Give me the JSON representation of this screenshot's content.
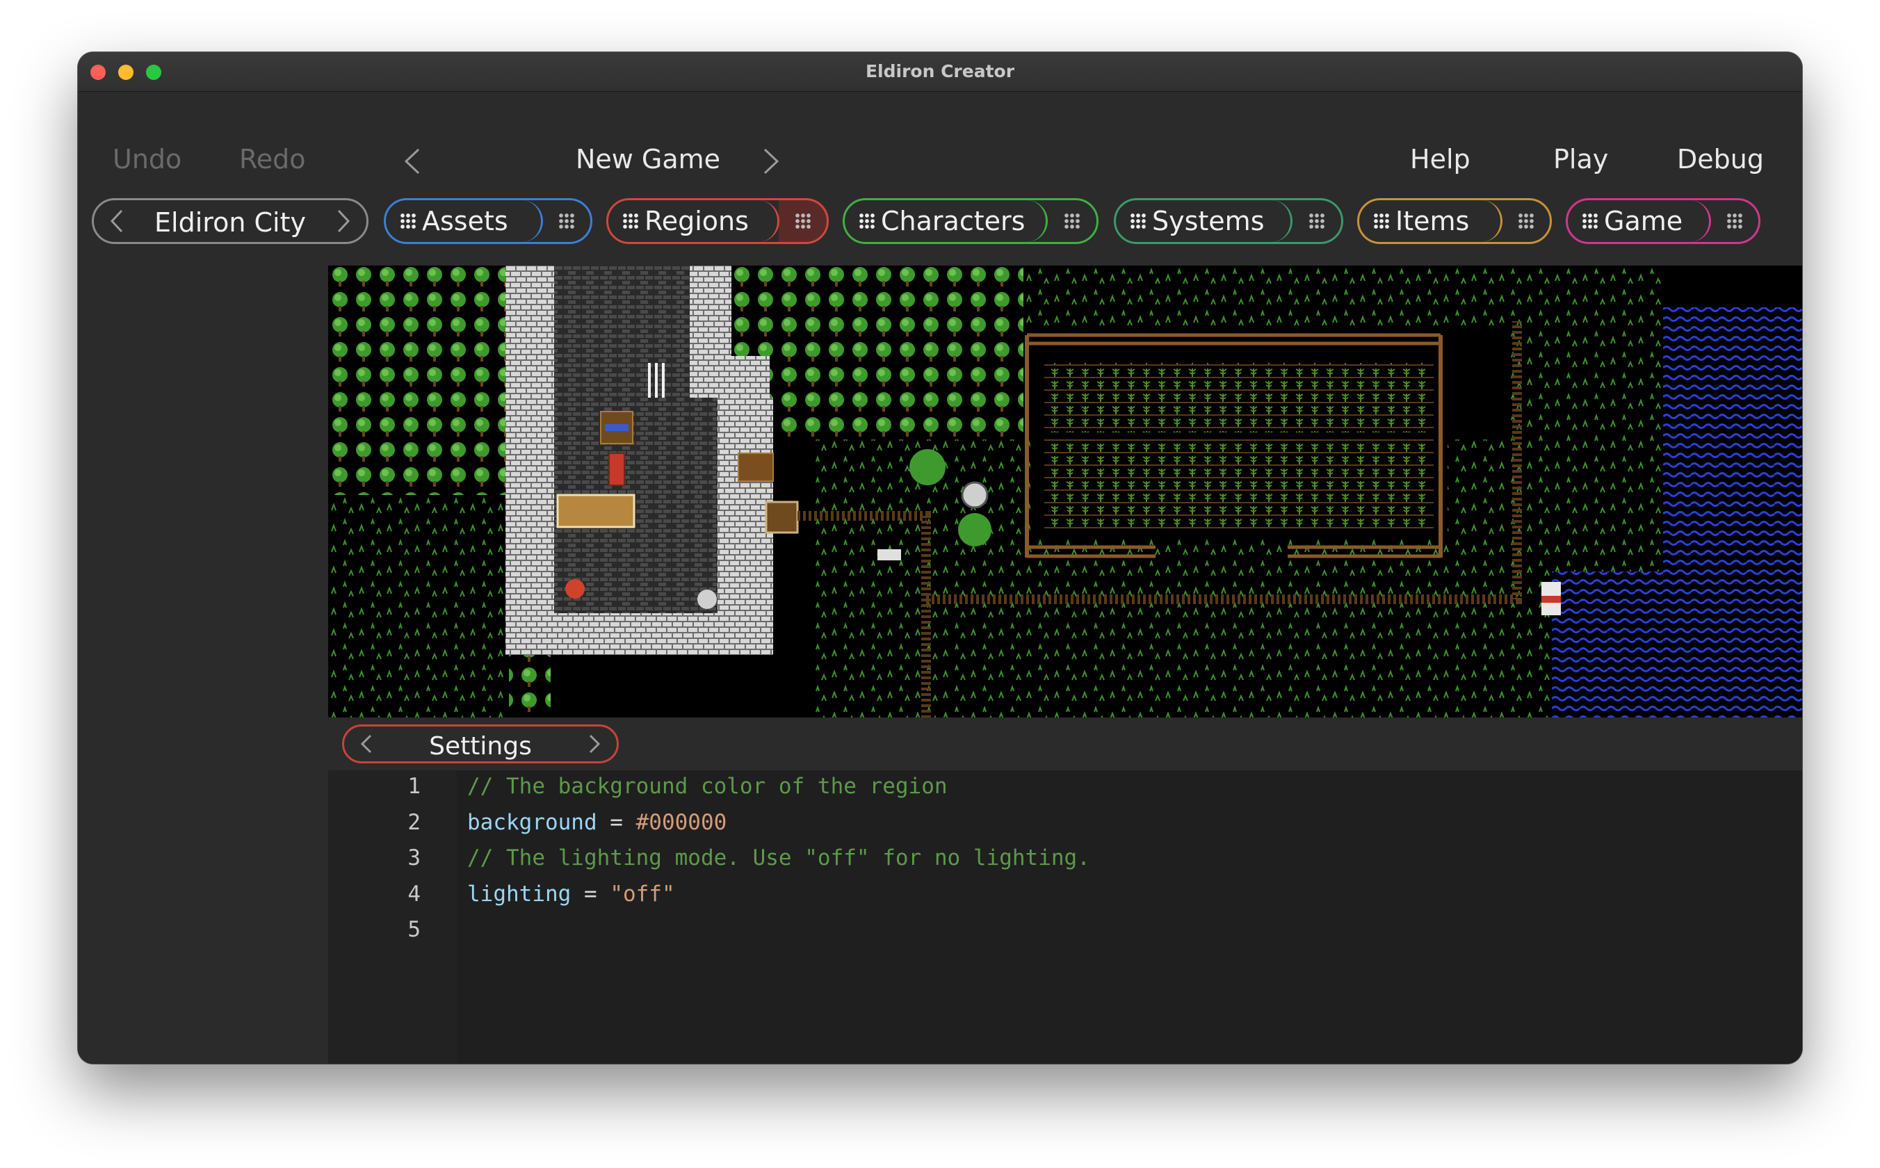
{
  "window": {
    "title": "Eldiron Creator"
  },
  "toolbar": {
    "undo": "Undo",
    "redo": "Redo",
    "project": "New Game",
    "help": "Help",
    "play": "Play",
    "debug": "Debug"
  },
  "region_selector": {
    "label": "Eldiron City"
  },
  "tabs": [
    {
      "label": "Assets",
      "color": "#3b7fd6"
    },
    {
      "label": "Regions",
      "color": "#d2473c"
    },
    {
      "label": "Characters",
      "color": "#3fb03f"
    },
    {
      "label": "Systems",
      "color": "#3a9a6a"
    },
    {
      "label": "Items",
      "color": "#c8913a"
    },
    {
      "label": "Game",
      "color": "#d0368f"
    }
  ],
  "settings": {
    "label": "Settings"
  },
  "editor": {
    "lines": [
      {
        "num": "1",
        "parts": [
          {
            "t": "// The background color of the region",
            "k": "comment"
          }
        ]
      },
      {
        "num": "2",
        "parts": [
          {
            "t": "background",
            "k": "key"
          },
          {
            "t": " = ",
            "k": "op"
          },
          {
            "t": "#000000",
            "k": "hex"
          }
        ]
      },
      {
        "num": "3",
        "parts": [
          {
            "t": "// The lighting mode. Use \"off\" for no lighting.",
            "k": "comment"
          }
        ]
      },
      {
        "num": "4",
        "parts": [
          {
            "t": "lighting",
            "k": "key"
          },
          {
            "t": " = ",
            "k": "op"
          },
          {
            "t": "\"off\"",
            "k": "str"
          }
        ]
      },
      {
        "num": "5",
        "parts": []
      }
    ]
  }
}
